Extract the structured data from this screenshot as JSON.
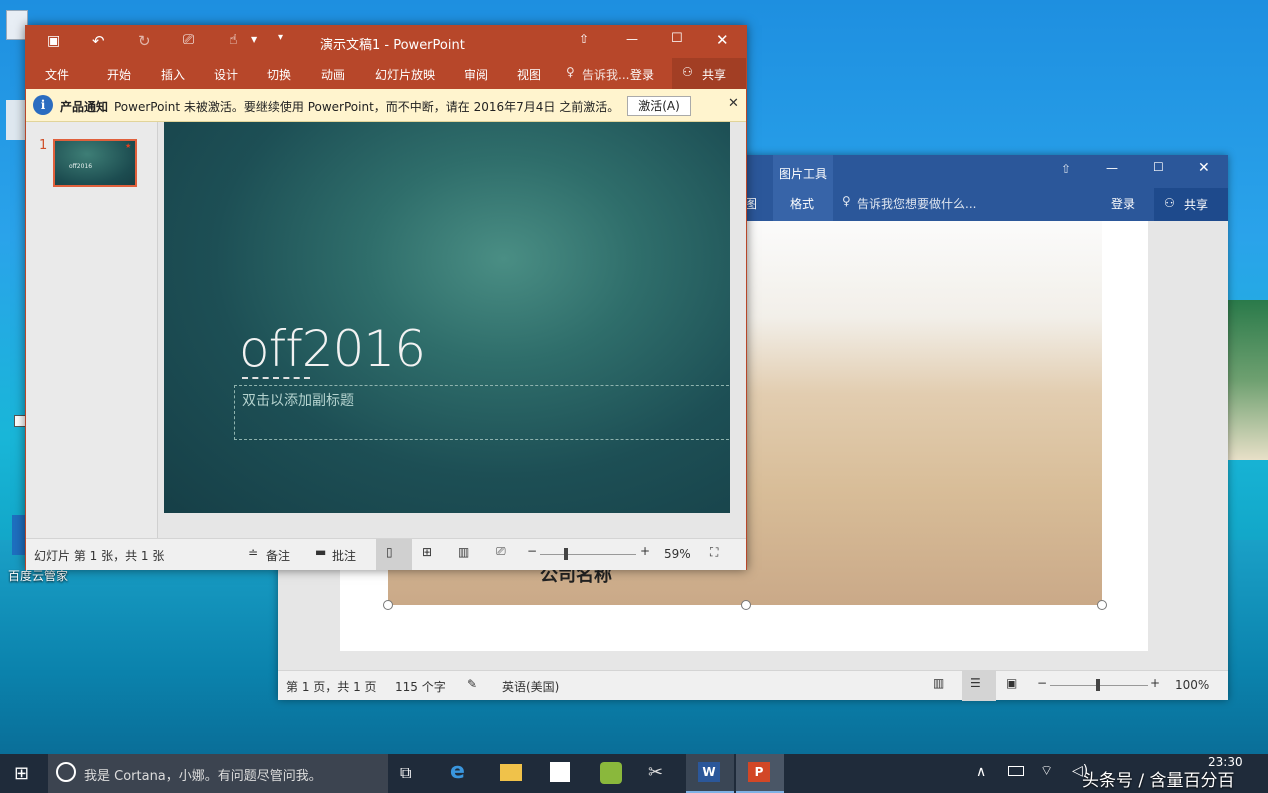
{
  "desktop": {
    "label_baidu": "百度云管家"
  },
  "ppt": {
    "title": "演示文稿1 - PowerPoint",
    "tabs": [
      "文件",
      "开始",
      "插入",
      "设计",
      "切换",
      "动画",
      "幻灯片放映",
      "审阅",
      "视图"
    ],
    "tell_me": "告诉我...",
    "login": "登录",
    "share": "共享",
    "notice_label": "产品通知",
    "notice_text": "PowerPoint 未被激活。要继续使用 PowerPoint，而不中断，请在 2016年7月4日 之前激活。",
    "activate_btn": "激活(A)",
    "slide_number": "1",
    "thumb_text": "off2016",
    "slide_title": "off2016",
    "slide_subtitle_placeholder": "双击以添加副标题",
    "status_slide": "幻灯片 第 1 张，共 1 张",
    "notes": "备注",
    "comments": "批注",
    "zoom": "59%",
    "zoom_level": 0.59,
    "accent": "#b7472a"
  },
  "word": {
    "picture_tools": "图片工具",
    "tab_partial": "图",
    "tab_format": "格式",
    "tell_me": "告诉我您想要做什么...",
    "login": "登录",
    "share": "共享",
    "doc_text": "公司名称",
    "status_page": "第 1 页，共 1 页",
    "status_words": "115 个字",
    "status_lang": "英语(美国)",
    "zoom": "100%",
    "accent": "#2b579a"
  },
  "taskbar": {
    "cortana_text": "我是 Cortana，小娜。有问题尽管问我。",
    "time": "23:30",
    "watermark": "头条号 / 含量百分百"
  }
}
